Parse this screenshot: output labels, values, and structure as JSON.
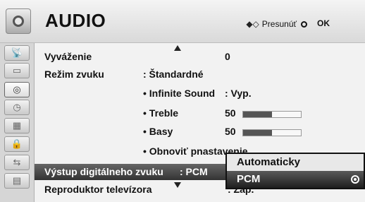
{
  "header": {
    "title": "AUDIO",
    "hint_move": "Presunúť",
    "hint_ok": "OK"
  },
  "sidebar": {
    "items": [
      {
        "icon": "antenna-icon"
      },
      {
        "icon": "screen-icon"
      },
      {
        "icon": "audio-icon",
        "active": true
      },
      {
        "icon": "clock-icon"
      },
      {
        "icon": "calendar-icon"
      },
      {
        "icon": "lock-icon"
      },
      {
        "icon": "input-icon"
      },
      {
        "icon": "usb-icon"
      }
    ]
  },
  "menu": {
    "balance_label": "Vyváženie",
    "balance_value": "0",
    "sound_mode_label": "Režim  zvuku",
    "sound_mode_value": ": Štandardné",
    "infinite_label": "• Infinite Sound",
    "infinite_value": ": Vyp.",
    "treble_label": "• Treble",
    "treble_value": "50",
    "treble_level": 0.5,
    "bass_label": "• Basy",
    "bass_value": "50",
    "bass_level": 0.5,
    "reset_label": "• Obnoviť pnastavenie",
    "digital_out_label": "Výstup digitálneho zvuku",
    "digital_out_value": ": PCM",
    "tv_speaker_label": "Reproduktor televízora",
    "tv_speaker_value": ": Zap."
  },
  "popup": {
    "options": [
      "Automaticky",
      "PCM"
    ],
    "selected": "PCM"
  }
}
